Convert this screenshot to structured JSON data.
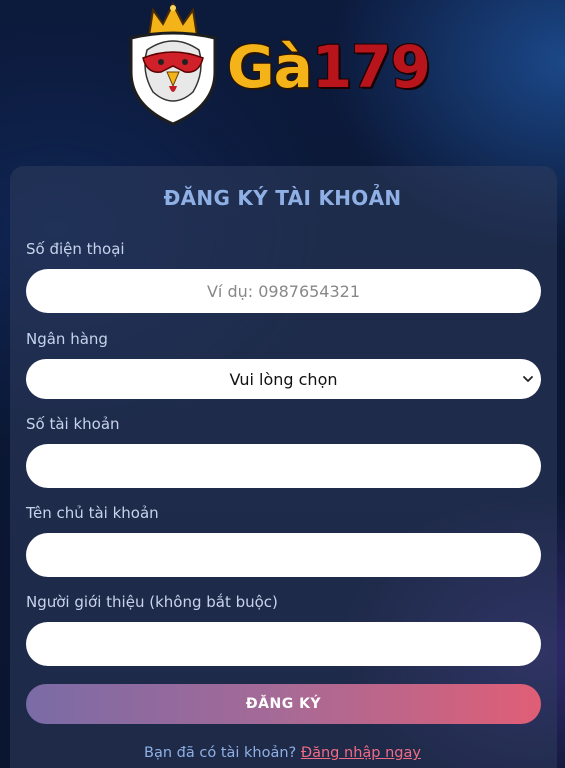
{
  "brand": {
    "name_part1": "Gà",
    "name_part2": "179",
    "colors": {
      "gold": "#f3b319",
      "red": "#b8141c"
    }
  },
  "form": {
    "title": "ĐĂNG KÝ TÀI KHOẢN",
    "phone": {
      "label": "Số điện thoại",
      "placeholder": "Ví dụ: 0987654321",
      "value": ""
    },
    "bank": {
      "label": "Ngân hàng",
      "selected": "Vui lòng chọn"
    },
    "account_number": {
      "label": "Số tài khoản",
      "value": ""
    },
    "account_holder": {
      "label": "Tên chủ tài khoản",
      "value": ""
    },
    "referrer": {
      "label": "Người giới thiệu (không bắt buộc)",
      "value": ""
    },
    "submit_label": "ĐĂNG KÝ"
  },
  "footer": {
    "prompt": "Bạn đã có tài khoản?",
    "login_link": "Đăng nhập ngay"
  },
  "colors": {
    "title": "#8fb0e4",
    "label": "#c7d3ec",
    "link": "#ef6b86",
    "button_gradient_start": "#7a6ba6",
    "button_gradient_end": "#e05e76"
  }
}
